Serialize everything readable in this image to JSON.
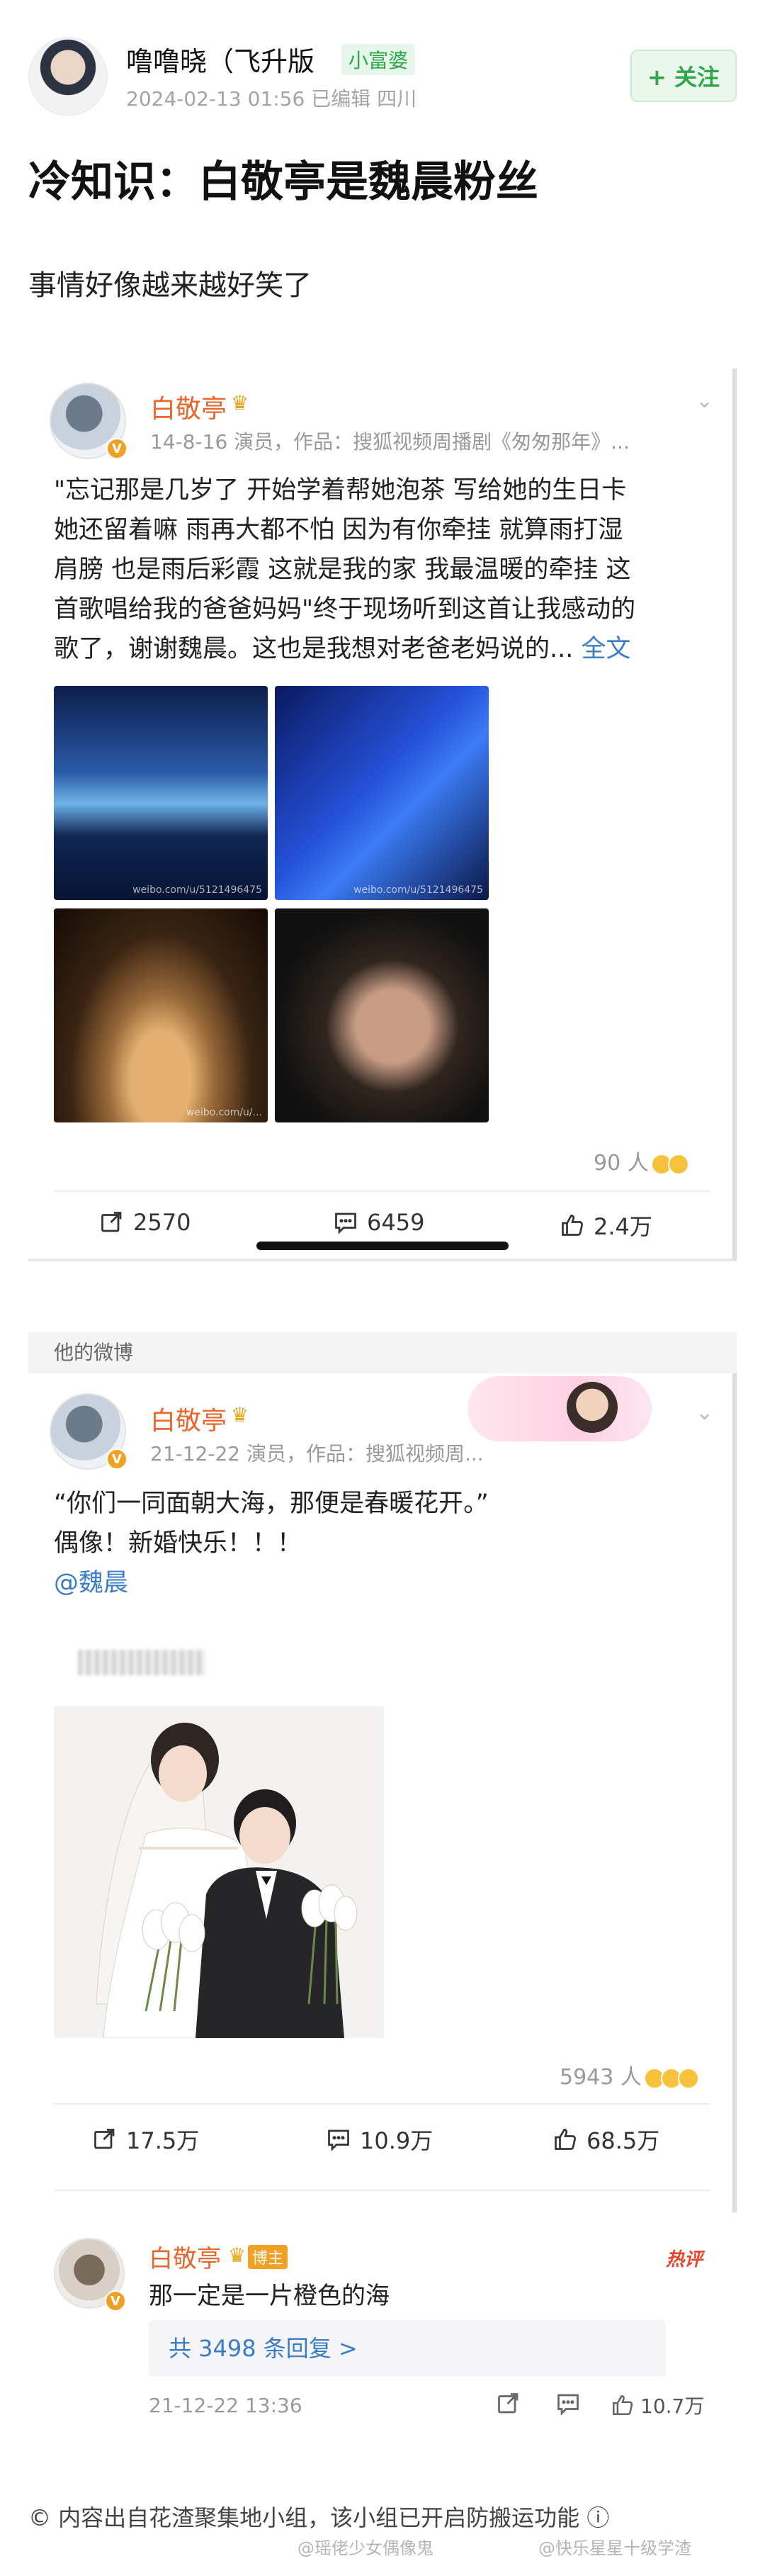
{
  "post": {
    "author": "噜噜晓（飞升版",
    "badge": "小富婆",
    "meta": "2024-02-13 01:56 已编辑 四川",
    "follow_label": "+ 关注",
    "title": "冷知识：白敬亭是魏晨粉丝",
    "body": "事情好像越来越好笑了"
  },
  "card1": {
    "name": "白敬亭",
    "meta": "14-8-16 演员，作品：搜狐视频周播剧《匆匆那年》...",
    "text_lines": [
      "\"忘记那是几岁了 开始学着帮她泡茶 写给她的生日卡",
      "她还留着嘛 雨再大都不怕 因为有你牵挂 就算雨打湿",
      "肩膀 也是雨后彩霞 这就是我的家 我最温暖的牵挂 这",
      "首歌唱给我的爸爸妈妈\"终于现场听到这首让我感动的",
      "歌了，谢谢魏晨。这也是我想对老爸老妈说的..."
    ],
    "more_link": "全文",
    "photos": [
      {
        "label": "weibo.com/u/5121496475"
      },
      {
        "label": "weibo.com/u/5121496475"
      },
      {
        "label": "weibo.com/u/..."
      },
      {
        "label": ""
      }
    ],
    "likes_count": "90 人",
    "repost": "2570",
    "comment": "6459",
    "like": "2.4万"
  },
  "section_label": "他的微博",
  "card2": {
    "name": "白敬亭",
    "meta": "21-12-22 演员，作品：搜狐视频周...",
    "text_lines": [
      "“你们一同面朝大海，那便是春暖花开。”",
      "  偶像！新婚快乐！！！"
    ],
    "mention": "@魏晨",
    "likes_count": "5943 人",
    "repost": "17.5万",
    "comment": "10.9万",
    "like": "68.5万"
  },
  "comment": {
    "name": "白敬亭",
    "badge": "博主",
    "hot": "热评",
    "text": "那一定是一片橙色的海",
    "replies": "共 3498 条回复 >",
    "time": "21-12-22 13:36",
    "like": "10.7万"
  },
  "footer": {
    "text": "© 内容出自花渣聚集地小组，该小组已开启防搬运功能 ⓘ",
    "watermark_left": "@瑶佬少女偶像鬼",
    "watermark_right": "@快乐星星十级学渣"
  },
  "colors": {
    "accent_green": "#2fa64a",
    "weibo_orange": "#e8652b",
    "link_blue": "#3a7cc6",
    "hot_red": "#e8472b"
  },
  "icons": [
    "repost-icon",
    "comment-icon",
    "like-icon",
    "follow-plus-icon",
    "chevron-down-icon",
    "verified-v-icon",
    "crown-icon",
    "copyright-icon",
    "info-icon"
  ]
}
